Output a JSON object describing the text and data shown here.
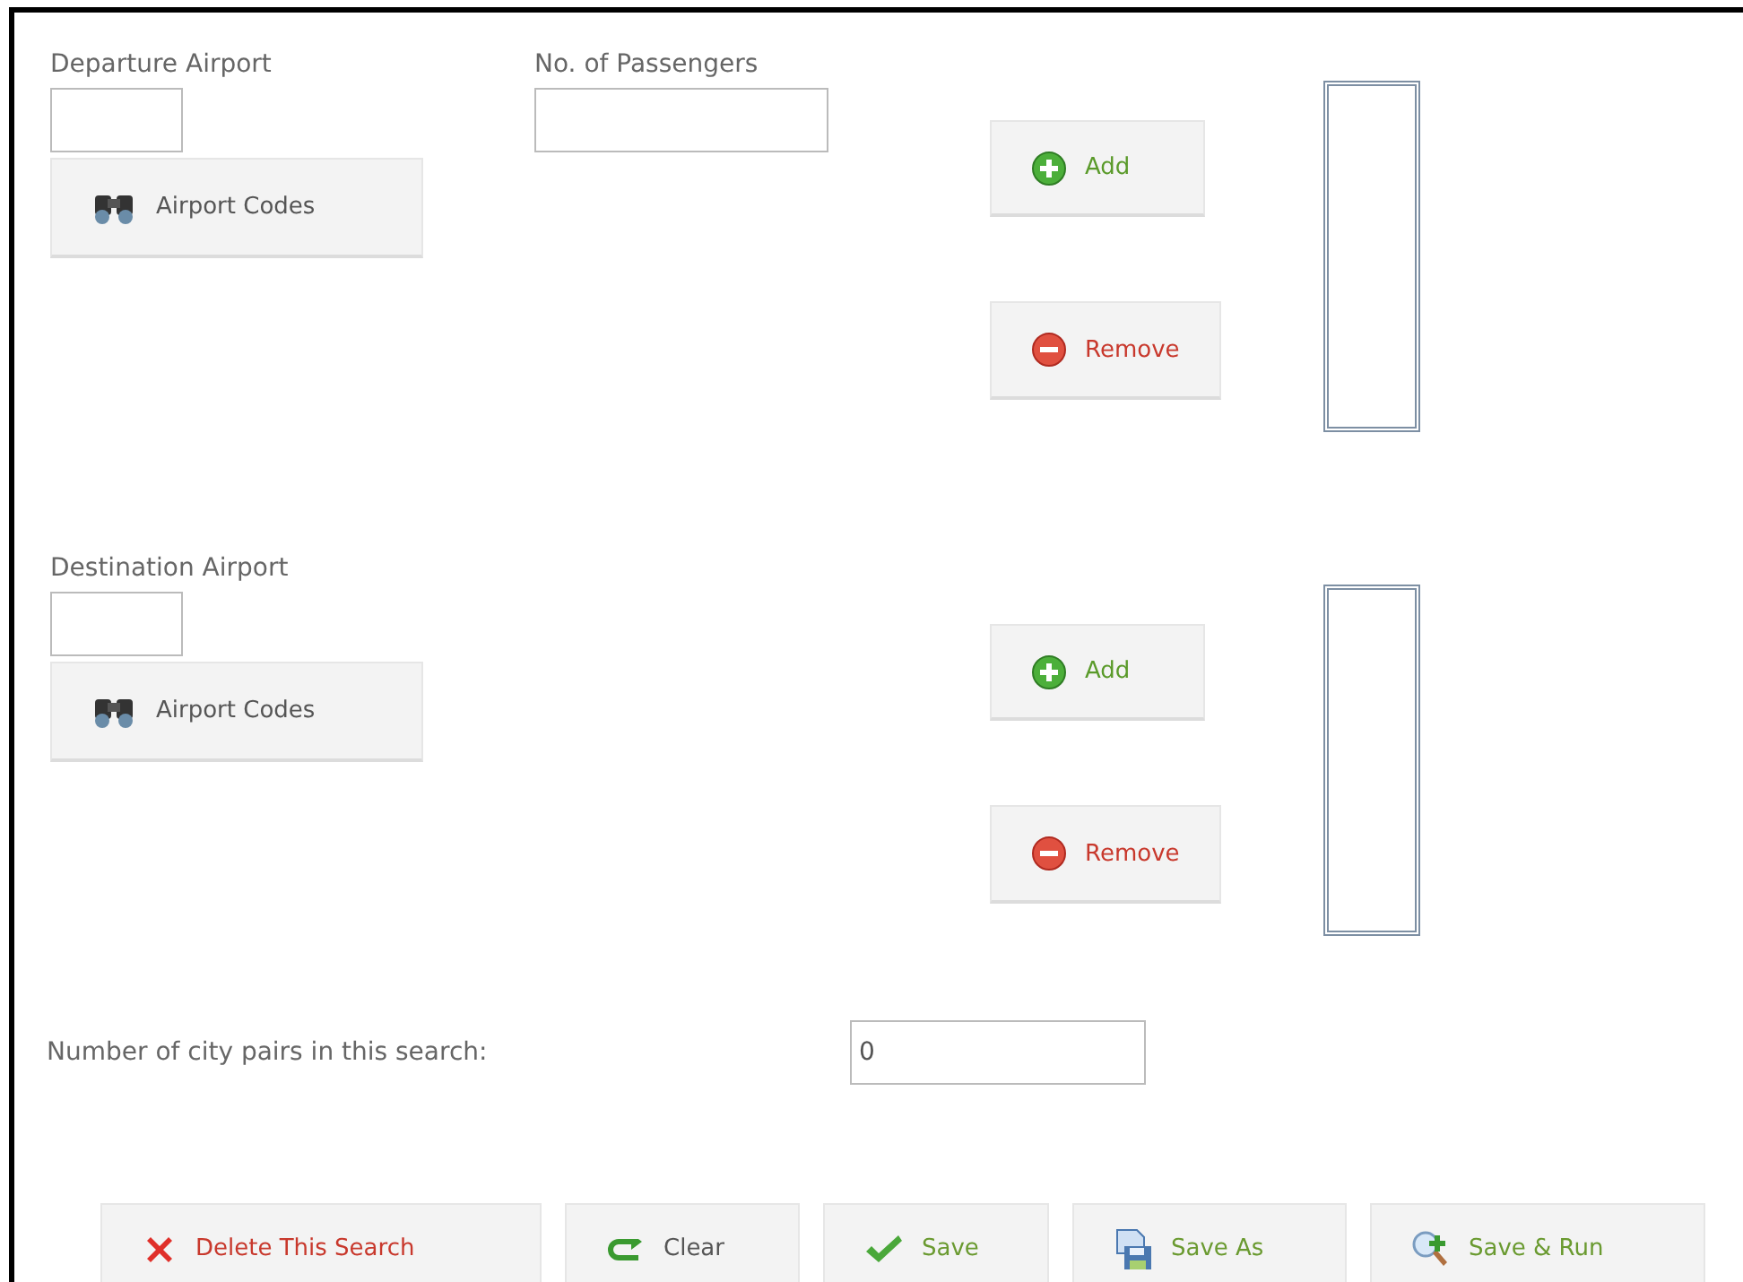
{
  "sections": [
    {
      "label": "Departure Airport",
      "codes_button": "Airport Codes",
      "passengers": {
        "label": "No. of Passengers"
      },
      "add_button": "Add",
      "remove_button": "Remove"
    },
    {
      "label": "Destination Airport",
      "codes_button": "Airport Codes",
      "add_button": "Add",
      "remove_button": "Remove"
    }
  ],
  "summary": {
    "label": "Number of city pairs in this search:",
    "value": "0"
  },
  "actions": [
    {
      "kind": "delete",
      "label": "Delete This Search"
    },
    {
      "kind": "clear",
      "label": "Clear"
    },
    {
      "kind": "save",
      "label": "Save"
    },
    {
      "kind": "save-as",
      "label": "Save As"
    },
    {
      "kind": "save-run",
      "label": "Save & Run"
    }
  ]
}
